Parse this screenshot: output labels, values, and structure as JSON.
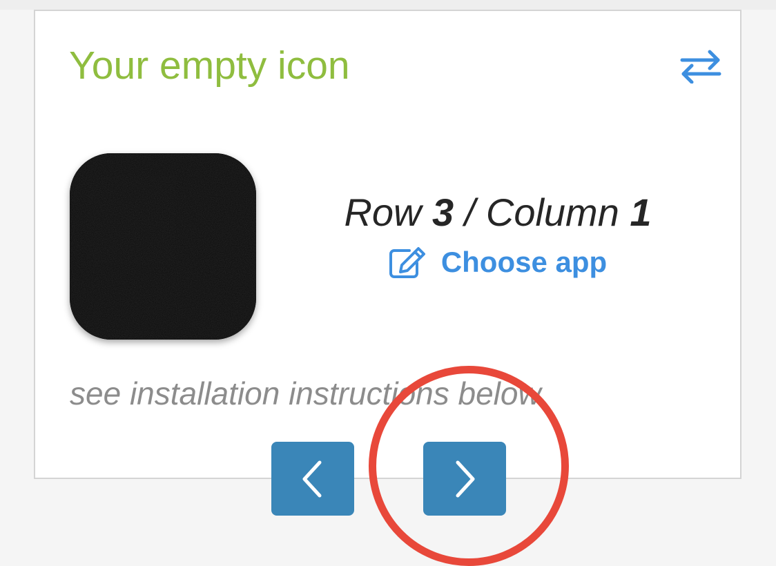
{
  "colors": {
    "title": "#8fbd3f",
    "link": "#3d8fe0",
    "nav_button": "#3a86b8",
    "nav_chevron": "#ffffff",
    "highlight": "#e8483a"
  },
  "card": {
    "title": "Your empty icon",
    "swap_icon": "swap-arrows-icon"
  },
  "position": {
    "row_label": "Row",
    "row_value": "3",
    "separator": "/",
    "column_label": "Column",
    "column_value": "1"
  },
  "choose_app": {
    "icon": "edit-icon",
    "label": "Choose app"
  },
  "hint": "see installation instructions below",
  "navigation": {
    "prev_icon": "chevron-left-icon",
    "next_icon": "chevron-right-icon"
  }
}
